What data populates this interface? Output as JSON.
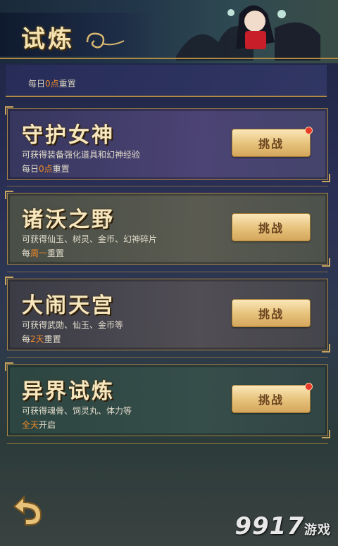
{
  "header": {
    "title": "试炼"
  },
  "partial_card": {
    "reset_prefix": "每日",
    "reset_highlight": "0点",
    "reset_suffix": "重置"
  },
  "cards": [
    {
      "name": "守护女神",
      "desc": "可获得装备强化道具和幻神经验",
      "reset_prefix": "每日",
      "reset_highlight": "0点",
      "reset_suffix": "重置",
      "button": "挑战",
      "has_dot": true
    },
    {
      "name": "诸沃之野",
      "desc": "可获得仙玉、树灵、金币、幻神碎片",
      "reset_prefix": "每",
      "reset_highlight": "周一",
      "reset_suffix": "重置",
      "button": "挑战",
      "has_dot": false
    },
    {
      "name": "大闹天宫",
      "desc": "可获得武勋、仙玉、金币等",
      "reset_prefix": "每",
      "reset_highlight": "2天",
      "reset_suffix": "重置",
      "button": "挑战",
      "has_dot": false
    },
    {
      "name": "异界试炼",
      "desc": "可获得魂骨、饲灵丸、体力等",
      "reset_prefix": "",
      "reset_highlight": "全天",
      "reset_suffix": "开启",
      "button": "挑战",
      "has_dot": true
    }
  ],
  "footer": {
    "back_icon": "back-arrow-icon",
    "watermark_main": "9917",
    "watermark_sub": "游戏"
  },
  "colors": {
    "accent_gold": "#b08a45",
    "highlight_orange": "#f08a28",
    "notify_red": "#e83a2a"
  }
}
